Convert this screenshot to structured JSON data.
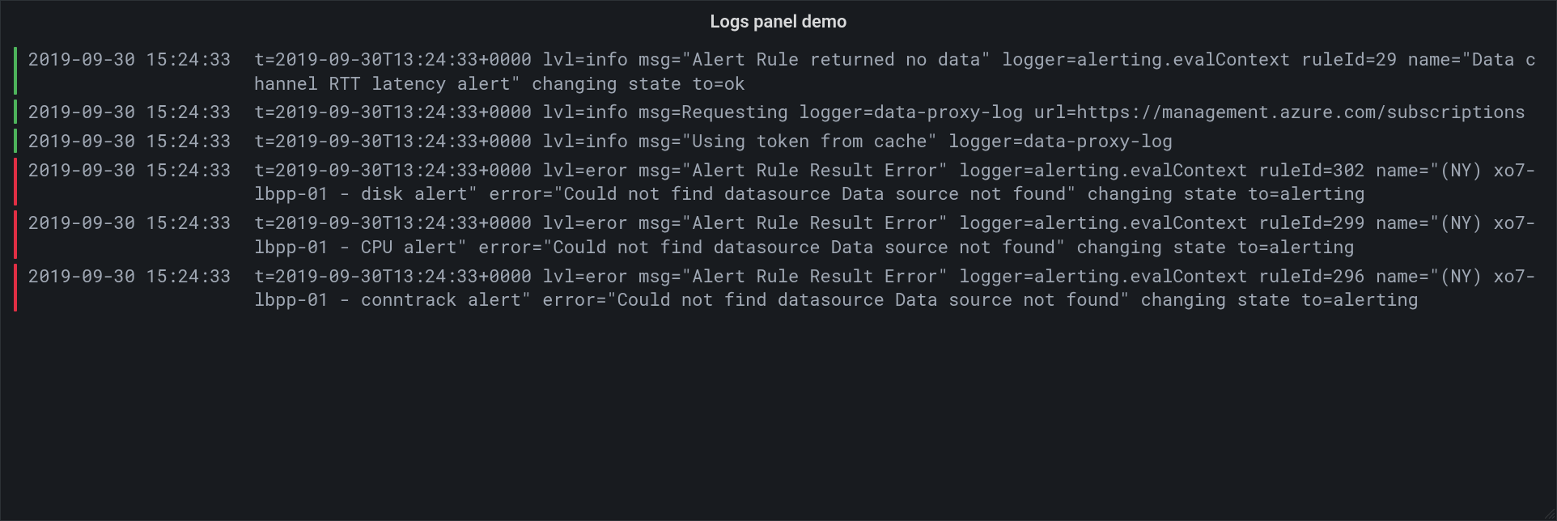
{
  "panel": {
    "title": "Logs panel demo"
  },
  "logs": [
    {
      "level": "info",
      "timestamp": "2019-09-30 15:24:33",
      "message": "t=2019-09-30T13:24:33+0000 lvl=info msg=\"Alert Rule returned no data\" logger=alerting.evalContext ruleId=29 name=\"Data channel RTT latency alert\" changing state to=ok"
    },
    {
      "level": "info",
      "timestamp": "2019-09-30 15:24:33",
      "message": "t=2019-09-30T13:24:33+0000 lvl=info msg=Requesting logger=data-proxy-log url=https://management.azure.com/subscriptions"
    },
    {
      "level": "info",
      "timestamp": "2019-09-30 15:24:33",
      "message": "t=2019-09-30T13:24:33+0000 lvl=info msg=\"Using token from cache\" logger=data-proxy-log"
    },
    {
      "level": "error",
      "timestamp": "2019-09-30 15:24:33",
      "message": "t=2019-09-30T13:24:33+0000 lvl=eror msg=\"Alert Rule Result Error\" logger=alerting.evalContext ruleId=302 name=\"(NY) xo7-lbpp-01 - disk alert\" error=\"Could not find datasource Data source not found\" changing state to=alerting"
    },
    {
      "level": "error",
      "timestamp": "2019-09-30 15:24:33",
      "message": "t=2019-09-30T13:24:33+0000 lvl=eror msg=\"Alert Rule Result Error\" logger=alerting.evalContext ruleId=299 name=\"(NY) xo7-lbpp-01 - CPU alert\" error=\"Could not find datasource Data source not found\" changing state to=alerting"
    },
    {
      "level": "error",
      "timestamp": "2019-09-30 15:24:33",
      "message": "t=2019-09-30T13:24:33+0000 lvl=eror msg=\"Alert Rule Result Error\" logger=alerting.evalContext ruleId=296 name=\"(NY) xo7-lbpp-01 - conntrack alert\" error=\"Could not find datasource Data source not found\" changing state to=alerting"
    }
  ]
}
